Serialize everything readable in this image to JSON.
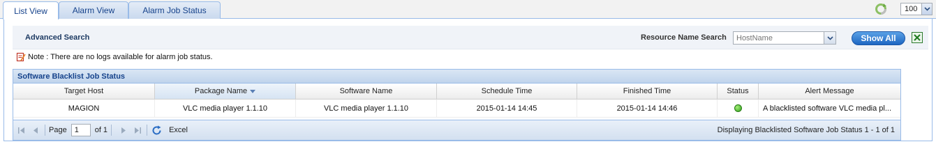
{
  "tabs": [
    {
      "label": "List View",
      "active": true
    },
    {
      "label": "Alarm View",
      "active": false
    },
    {
      "label": "Alarm Job Status",
      "active": false
    }
  ],
  "page_size": "100",
  "search": {
    "advanced_label": "Advanced Search",
    "resource_label": "Resource Name Search",
    "placeholder": "HostName",
    "show_all_label": "Show All"
  },
  "note": "Note : There are no logs available for alarm job status.",
  "grid": {
    "title": "Software Blacklist Job Status",
    "columns": [
      "Target Host",
      "Package Name",
      "Software Name",
      "Schedule Time",
      "Finished Time",
      "Status",
      "Alert Message"
    ],
    "sorted_column": "Package Name",
    "rows": [
      {
        "target_host": "MAGION",
        "package_name": "VLC media player 1.1.10",
        "software_name": "VLC media player 1.1.10",
        "schedule_time": "2015-01-14 14:45",
        "finished_time": "2015-01-14 14:46",
        "status": "success",
        "alert_message": "A blacklisted software VLC media pl..."
      }
    ]
  },
  "pager": {
    "page_label": "Page",
    "page_value": "1",
    "of_label": "of 1",
    "excel_label": "Excel",
    "info": "Displaying Blacklisted Software Job Status 1 - 1 of 1"
  },
  "colors": {
    "accent": "#15428b",
    "border": "#99bbe8",
    "status_ok": "#2e9c19"
  }
}
